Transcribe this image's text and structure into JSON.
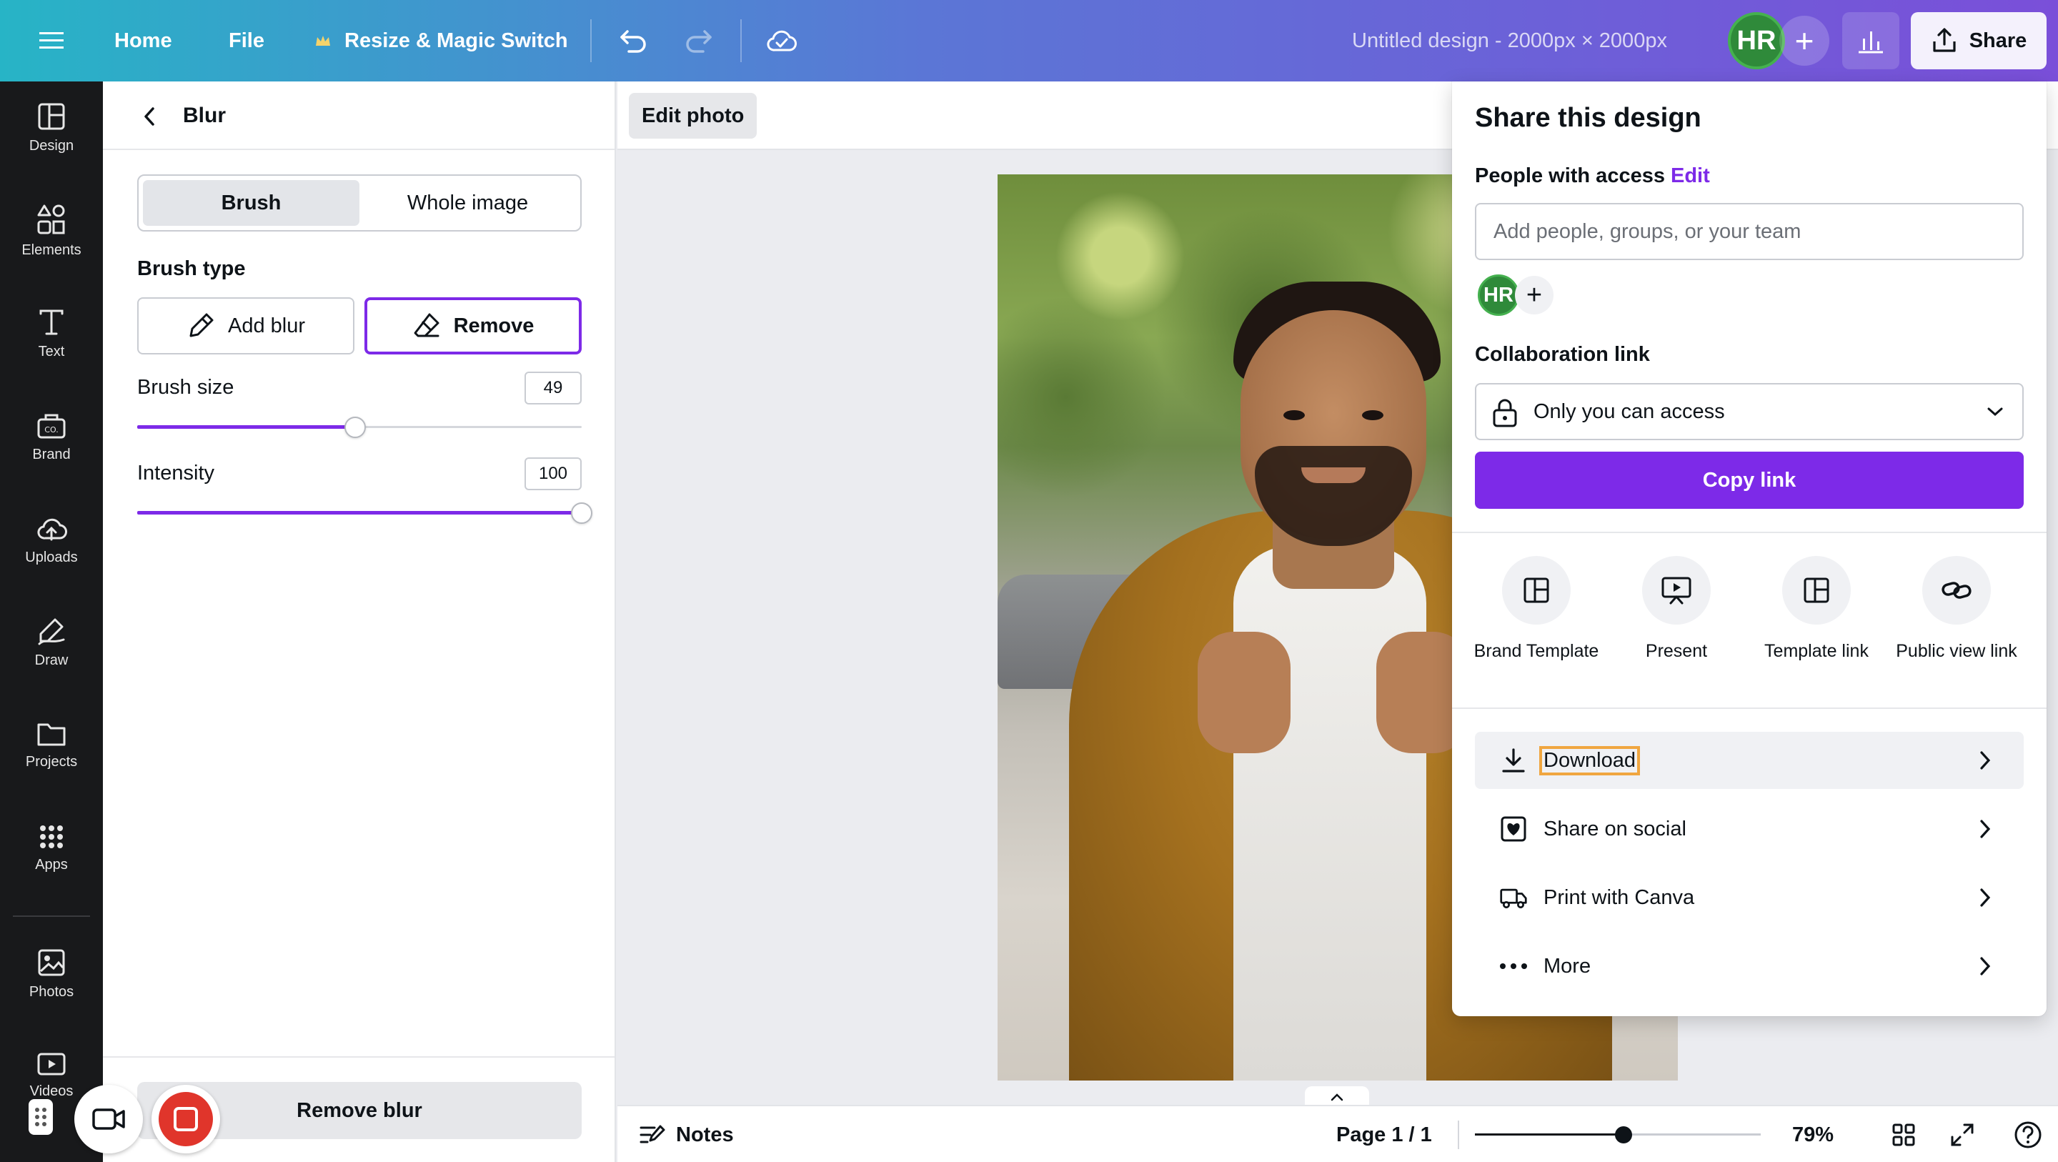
{
  "topbar": {
    "home": "Home",
    "file": "File",
    "resize": "Resize & Magic Switch",
    "doc_title": "Untitled design - 2000px × 2000px",
    "avatar_initials": "HR",
    "share": "Share"
  },
  "rail": {
    "items": [
      {
        "label": "Design",
        "icon": "design-icon"
      },
      {
        "label": "Elements",
        "icon": "elements-icon"
      },
      {
        "label": "Text",
        "icon": "text-icon"
      },
      {
        "label": "Brand",
        "icon": "brand-icon"
      },
      {
        "label": "Uploads",
        "icon": "uploads-icon"
      },
      {
        "label": "Draw",
        "icon": "draw-icon"
      },
      {
        "label": "Projects",
        "icon": "projects-icon"
      },
      {
        "label": "Apps",
        "icon": "apps-icon"
      },
      {
        "label": "Photos",
        "icon": "photos-icon"
      },
      {
        "label": "Videos",
        "icon": "videos-icon"
      }
    ]
  },
  "panel": {
    "title": "Blur",
    "tabs": [
      "Brush",
      "Whole image"
    ],
    "active_tab": "Brush",
    "brush_type_label": "Brush type",
    "add_blur": "Add blur",
    "remove": "Remove",
    "brush_size_label": "Brush size",
    "brush_size": "49",
    "brush_size_fraction": 0.49,
    "intensity_label": "Intensity",
    "intensity": "100",
    "intensity_fraction": 1.0,
    "remove_blur": "Remove blur"
  },
  "canvas": {
    "edit_photo": "Edit photo"
  },
  "bottombar": {
    "notes": "Notes",
    "page": "Page 1 / 1",
    "zoom": "79%",
    "zoom_fraction": 0.52
  },
  "share_panel": {
    "title": "Share this design",
    "people_label": "People with access",
    "edit": "Edit",
    "input_placeholder": "Add people, groups, or your team",
    "avatar_initials": "HR",
    "collab_label": "Collaboration link",
    "access": "Only you can access",
    "copy_link": "Copy link",
    "options": [
      {
        "label": "Brand Template",
        "icon": "brand-template-icon"
      },
      {
        "label": "Present",
        "icon": "present-icon"
      },
      {
        "label": "Template link",
        "icon": "template-link-icon"
      },
      {
        "label": "Public view link",
        "icon": "public-link-icon"
      }
    ],
    "rows": [
      {
        "label": "Download",
        "icon": "download-icon"
      },
      {
        "label": "Share on social",
        "icon": "share-social-icon"
      },
      {
        "label": "Print with Canva",
        "icon": "print-truck-icon"
      },
      {
        "label": "More",
        "icon": "more-dots-icon"
      }
    ]
  },
  "colors": {
    "accent": "#7d2ae8",
    "topbar_start": "#27b4c6",
    "topbar_end": "#7a4fd9",
    "rail_bg": "#18191b",
    "avatar": "#2f8a3a",
    "record": "#e0352b"
  }
}
